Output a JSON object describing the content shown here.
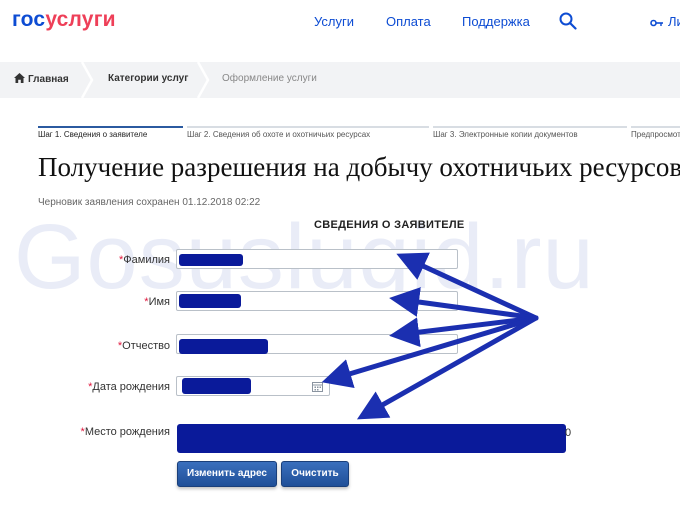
{
  "header": {
    "logo_part1": "гос",
    "logo_part2": "услуги",
    "nav": [
      "Услуги",
      "Оплата",
      "Поддержка"
    ],
    "login_label": "Ли"
  },
  "breadcrumbs": {
    "home": "Главная",
    "category": "Категории услуг",
    "current": "Оформление услуги"
  },
  "steps": [
    "Шаг 1. Сведения о заявителе",
    "Шаг 2. Сведения об охоте и охотничьих ресурсах",
    "Шаг 3. Электронные копии документов",
    "Предпросмотр"
  ],
  "page_title": "Получение разрешения на добычу охотничьих ресурсов",
  "draft_status": "Черновик заявления сохранен 01.12.2018 02:22",
  "section_title": "СВЕДЕНИЯ О ЗАЯВИТЕЛЕ",
  "watermark": "Gosuslugid.ru",
  "form": {
    "required_mark": "*",
    "surname_label": "Фамилия",
    "name_label": "Имя",
    "patronymic_label": "Отчество",
    "birthdate_label": "Дата рождения",
    "birthplace_label": "Место рождения",
    "birthplace_tail": "0"
  },
  "buttons": {
    "change_address": "Изменить адрес",
    "clear": "Очистить"
  },
  "colors": {
    "brand_blue": "#0d4cd3",
    "brand_red": "#ee3f58",
    "redaction": "#0a1a9a",
    "arrow": "#1b2fb0"
  }
}
